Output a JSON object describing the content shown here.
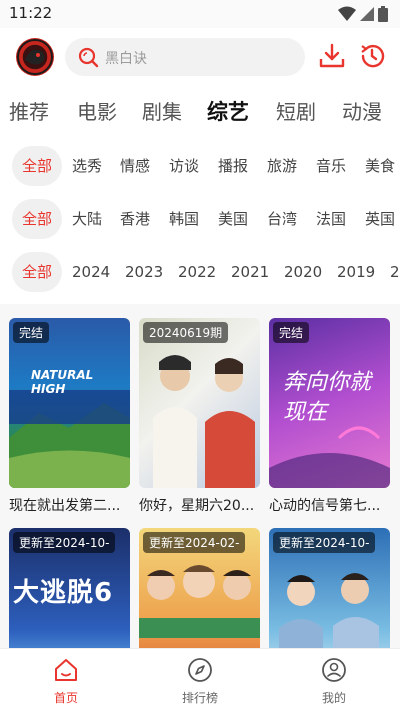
{
  "status_bar": {
    "time": "11:22"
  },
  "header": {
    "search_placeholder": "黑白诀"
  },
  "categories": [
    "推荐",
    "电影",
    "剧集",
    "综艺",
    "短剧",
    "动漫"
  ],
  "active_category": "综艺",
  "filters": {
    "genre": [
      "全部",
      "选秀",
      "情感",
      "访谈",
      "播报",
      "旅游",
      "音乐",
      "美食"
    ],
    "region": [
      "全部",
      "大陆",
      "香港",
      "韩国",
      "美国",
      "台湾",
      "法国",
      "英国"
    ],
    "year": [
      "全部",
      "2024",
      "2023",
      "2022",
      "2021",
      "2020",
      "2019",
      "2"
    ]
  },
  "cards": [
    {
      "badge": "完结",
      "title": "现在就出发第二...",
      "art_text": "NATURAL HIGH"
    },
    {
      "badge": "20240619期",
      "title": "你好，星期六20...",
      "art_text": ""
    },
    {
      "badge": "完结",
      "title": "心动的信号第七...",
      "art_text": "奔向你就现在"
    },
    {
      "badge": "更新至2024-10-",
      "title": "",
      "art_text": "大逃脱6"
    },
    {
      "badge": "更新至2024-02-",
      "title": "",
      "art_text": ""
    },
    {
      "badge": "更新至2024-10-",
      "title": "",
      "art_text": ""
    }
  ],
  "bottom_nav": [
    {
      "label": "首页",
      "icon": "home-icon",
      "active": true
    },
    {
      "label": "排行榜",
      "icon": "compass-icon",
      "active": false
    },
    {
      "label": "我的",
      "icon": "user-icon",
      "active": false
    }
  ],
  "colors": {
    "accent": "#e8352d",
    "chip_bg": "#f0f0f0"
  }
}
